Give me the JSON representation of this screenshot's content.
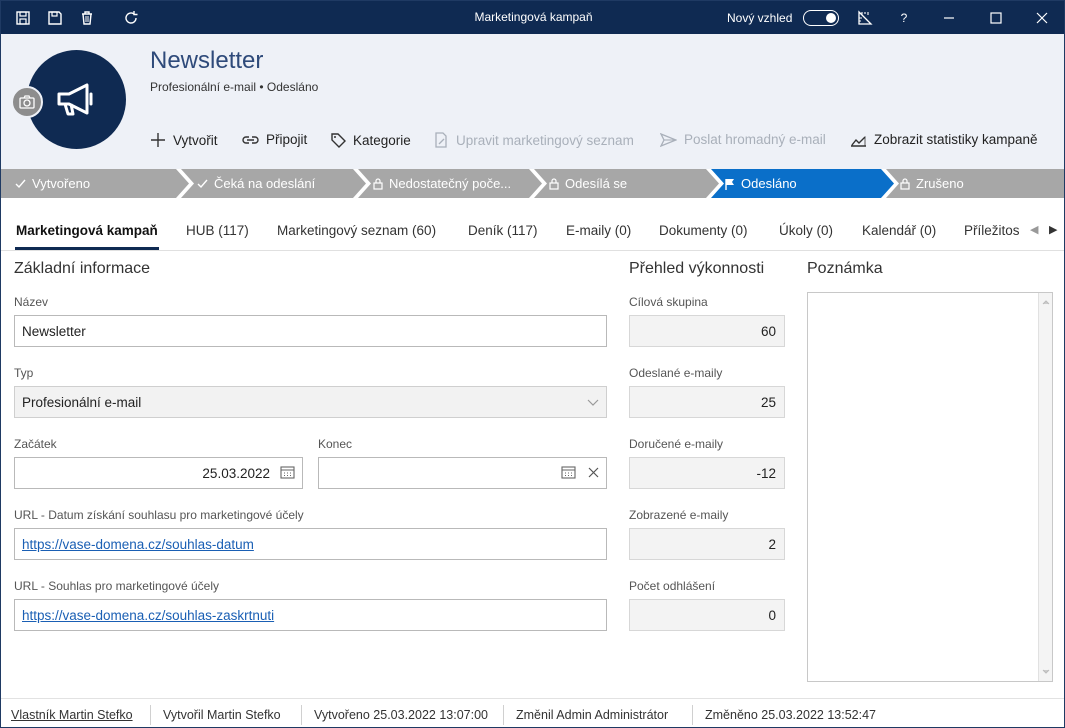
{
  "window": {
    "title": "Marketingová kampaň",
    "new_look_label": "Nový vzhled",
    "help_label": "?"
  },
  "record": {
    "title": "Newsletter",
    "subtitle": "Profesionální e-mail • Odesláno"
  },
  "commands": {
    "create": "Vytvořit",
    "attach": "Připojit",
    "category": "Kategorie",
    "edit_list": "Upravit marketingový seznam",
    "send_bulk": "Poslat hromadný e-mail",
    "show_stats": "Zobrazit statistiky kampaně"
  },
  "stages": [
    {
      "label": "Vytvořeno",
      "state": "done"
    },
    {
      "label": "Čeká na odeslání",
      "state": "done"
    },
    {
      "label": "Nedostatečný poče...",
      "state": "locked"
    },
    {
      "label": "Odesílá se",
      "state": "locked"
    },
    {
      "label": "Odesláno",
      "state": "active"
    },
    {
      "label": "Zrušeno",
      "state": "locked"
    }
  ],
  "tabs": [
    "Marketingová kampaň",
    "HUB (117)",
    "Marketingový seznam (60)",
    "Deník (117)",
    "E-maily (0)",
    "Dokumenty (0)",
    "Úkoly (0)",
    "Kalendář (0)",
    "Příležitos"
  ],
  "basic": {
    "title": "Základní informace",
    "name_label": "Název",
    "name_value": "Newsletter",
    "type_label": "Typ",
    "type_value": "Profesionální e-mail",
    "start_label": "Začátek",
    "start_value": "25.03.2022",
    "end_label": "Konec",
    "end_value": "",
    "url1_label": "URL - Datum získání souhlasu pro marketingové účely",
    "url1_value": "https://vase-domena.cz/souhlas-datum",
    "url2_label": "URL - Souhlas pro marketingové účely",
    "url2_value": "https://vase-domena.cz/souhlas-zaskrtnuti"
  },
  "performance": {
    "title": "Přehled výkonnosti",
    "items": [
      {
        "label": "Cílová skupina",
        "value": "60"
      },
      {
        "label": "Odeslané e-maily",
        "value": "25"
      },
      {
        "label": "Doručené e-maily",
        "value": "-12"
      },
      {
        "label": "Zobrazené e-maily",
        "value": "2"
      },
      {
        "label": "Počet odhlášení",
        "value": "0"
      }
    ]
  },
  "notes": {
    "title": "Poznámka"
  },
  "footer": {
    "owner": "Vlastník Martin Stefko",
    "created_by": "Vytvořil Martin Stefko",
    "created_at": "Vytvořeno 25.03.2022 13:07:00",
    "modified_by": "Změnil Admin Administrátor",
    "modified_at": "Změněno 25.03.2022 13:52:47"
  },
  "colors": {
    "navy": "#0f2a52",
    "stage_done": "#a7a7a7",
    "stage_active": "#0a6fc9",
    "link": "#1a5fb4"
  }
}
